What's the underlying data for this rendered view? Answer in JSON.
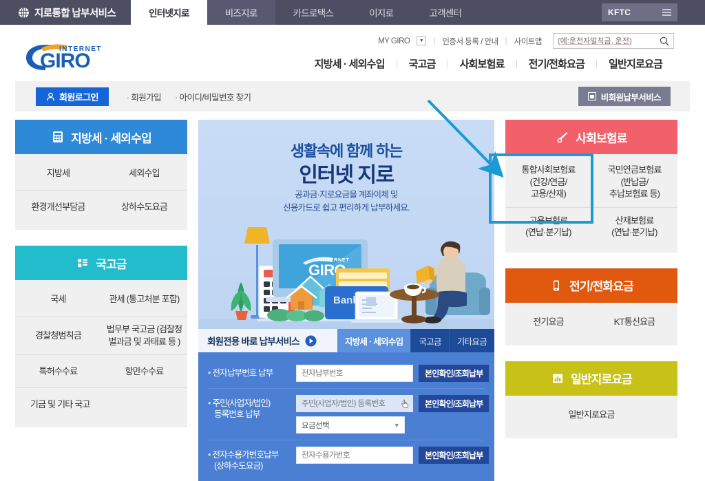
{
  "topbar": {
    "brand": "지로통합 납부서비스",
    "brand_icon": "globe-icon",
    "tabs": [
      {
        "label": "인터넷지로",
        "active": true
      },
      {
        "label": "비즈지로",
        "active": false
      },
      {
        "label": "카드로택스",
        "active": false
      },
      {
        "label": "이지로",
        "active": false
      },
      {
        "label": "고객센터",
        "active": false
      }
    ],
    "kftc_label": "KFTC",
    "menu_icon": "hamburger-icon"
  },
  "header": {
    "logo_top": "INTERNET",
    "logo_main": "GIRO",
    "utility": {
      "mygiro": "MY GIRO",
      "cert": "인증서 등록 / 안내",
      "sitemap": "사이트맵"
    },
    "search": {
      "placeholder": "(예:운전자벌칙금, 운전)",
      "value": "",
      "icon": "search-icon"
    },
    "nav": [
      "지방세 · 세외수입",
      "국고금",
      "사회보험료",
      "전기/전화요금",
      "일반지로요금"
    ]
  },
  "login_strip": {
    "login_button": "회원로그인",
    "signup": "회원가입",
    "find_id": "아이디/비밀번호 찾기",
    "nonmember_button": "비회원납부서비스"
  },
  "hero": {
    "title_small": "생활속에 함께 하는",
    "title_large": "인터넷 지로",
    "sub_line1": "공과금·지로요금을 계좌이체 및",
    "sub_line2": "신용카드로 쉽고 편리하게 납부하세요.",
    "art_logo_top": "INTERNET",
    "art_logo_main": "GIRO",
    "art_bank_label": "Bank"
  },
  "quickpay": {
    "title": "회원전용 바로 납부서비스",
    "play_icon": "play-circle-icon",
    "tabs": [
      {
        "label": "지방세 · 세외수입",
        "active": true
      },
      {
        "label": "국고금",
        "active": false
      },
      {
        "label": "기타요금",
        "active": false
      }
    ],
    "rows": [
      {
        "label_line1": "전자납부번호 납부",
        "label_line2": "",
        "input_placeholder": "전자납부번호",
        "input_value": "",
        "button": "본인확인/조회납부",
        "select": null
      },
      {
        "label_line1": "주민(사업자/법인)",
        "label_line2": "등록번호 납부",
        "input_placeholder": "주민(사업자/법인) 등록번호",
        "input_value": "",
        "button": "본인확인/조회납부",
        "select": "요금선택"
      },
      {
        "label_line1": "전자수용가번호납부",
        "label_line2": "(상하수도요금)",
        "input_placeholder": "전자수용가번호",
        "input_value": "",
        "button": "본인확인/조회납부",
        "select": null
      }
    ]
  },
  "panels": [
    {
      "id": "local-tax",
      "title": "지방세 · 세외수입",
      "icon": "calculator-icon",
      "color": "#2e8ad8",
      "column": "left",
      "items": [
        [
          "지방세",
          "세외수입"
        ],
        [
          "환경개선부담금",
          "상하수도요금"
        ]
      ]
    },
    {
      "id": "treasury",
      "title": "국고금",
      "icon": "list-icon",
      "color": "#23bccd",
      "column": "left",
      "items": [
        [
          "국세",
          "관세\n(통고처분 포함)"
        ],
        [
          "경찰청범칙금",
          "법무부 국고금\n(검찰청벌과금\n및 과태료 등 )"
        ],
        [
          "특허수수료",
          "항만수수료"
        ],
        [
          "기금 및 기타 국고",
          ""
        ]
      ]
    },
    {
      "id": "social-insurance",
      "title": "사회보험료",
      "icon": "pen-icon",
      "color": "#f2606a",
      "column": "right",
      "items": [
        [
          "통합사회보험료\n(건강/연금/\n고용/산재)",
          "국민연금보험료\n(반납금/\n추납보험료 등)"
        ],
        [
          "고용보험료\n(연납·분기납)",
          "산재보험료\n(연납·분기납)"
        ]
      ]
    },
    {
      "id": "utility",
      "title": "전기/전화요금",
      "icon": "phone-icon",
      "color": "#e1590f",
      "column": "right",
      "items": [
        [
          "전기요금",
          "KT통신요금"
        ]
      ]
    },
    {
      "id": "general-giro",
      "title": "일반지로요금",
      "icon": "chart-icon",
      "color": "#c8c118",
      "column": "right",
      "items": [
        [
          "일반지로요금",
          ""
        ]
      ]
    }
  ],
  "annotation": {
    "color": "#1b9ad4",
    "arrow": "pointer-arrow",
    "highlight_box": "highlight-rectangle",
    "target": "통합사회보험료 (건강/연금/고용/산재)"
  }
}
